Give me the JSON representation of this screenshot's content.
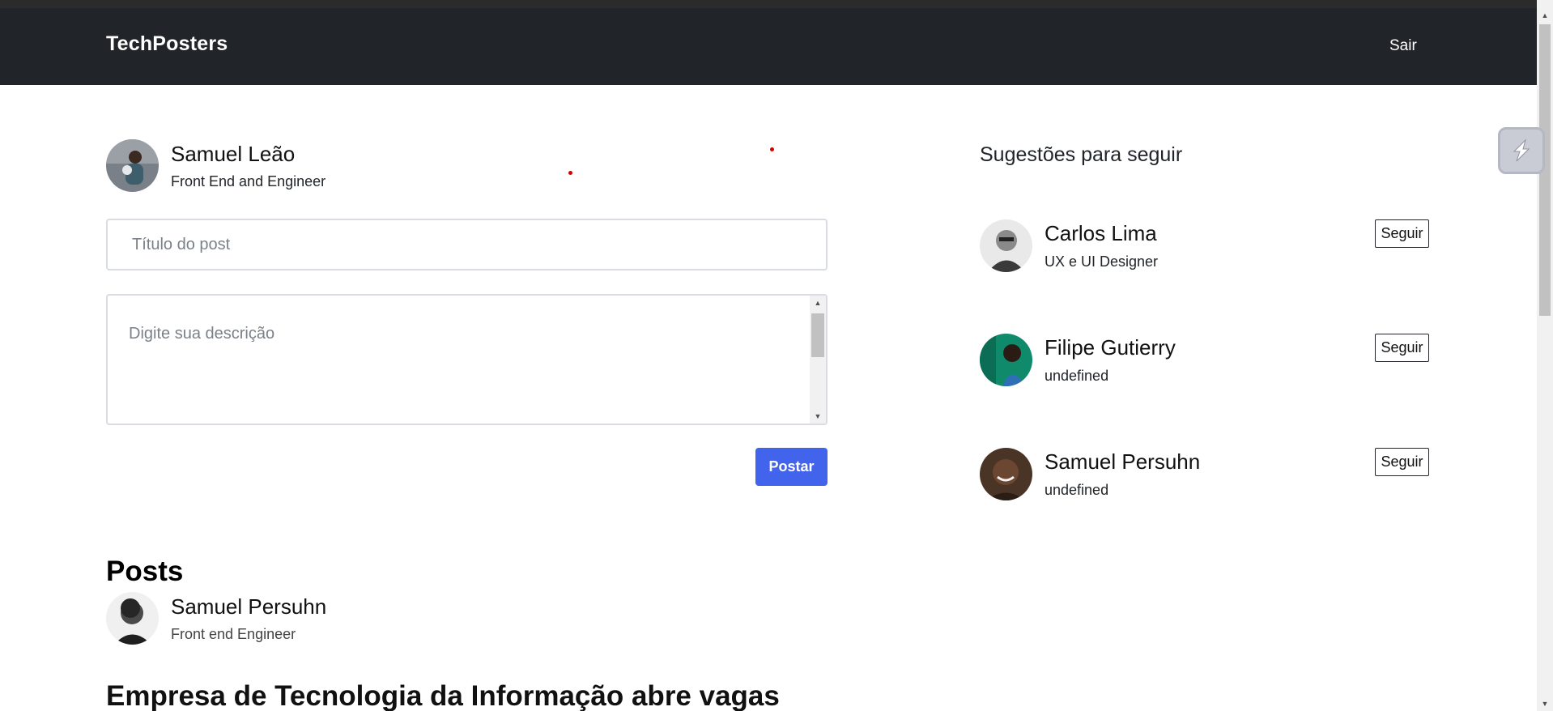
{
  "navbar": {
    "brand": "TechPosters",
    "logout_label": "Sair"
  },
  "current_user": {
    "name": "Samuel Leão",
    "role": "Front End and Engineer"
  },
  "post_form": {
    "title_placeholder": "Título do post",
    "description_placeholder": "Digite sua descrição",
    "submit_label": "Postar"
  },
  "suggestions": {
    "title": "Sugestões para seguir",
    "follow_label": "Seguir",
    "items": [
      {
        "name": "Carlos Lima",
        "role": "UX e UI Designer"
      },
      {
        "name": "Filipe Gutierry",
        "role": "undefined"
      },
      {
        "name": "Samuel Persuhn",
        "role": "undefined"
      }
    ]
  },
  "posts": {
    "heading": "Posts",
    "items": [
      {
        "author": "Samuel Persuhn",
        "author_role": "Front end Engineer",
        "title": "Empresa de Tecnologia da Informação abre vagas"
      }
    ]
  },
  "colors": {
    "navbar_bg": "#212529",
    "primary_button": "#4263eb"
  }
}
